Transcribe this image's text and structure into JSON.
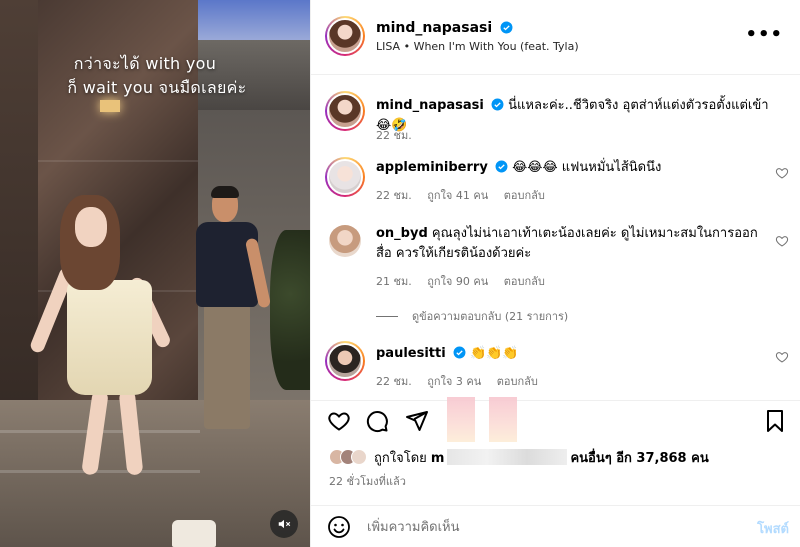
{
  "media": {
    "overlay_line1": "กว่าจะได้ with you",
    "overlay_line2": "ก็ wait you จนมืดเลยค่ะ",
    "mute_icon": "speaker-muted-icon"
  },
  "header": {
    "username": "mind_napasasi",
    "audio": "LISA • When I'm With You (feat. Tyla)",
    "more": "•••"
  },
  "caption": {
    "username": "mind_napasasi",
    "text": "นี่แหละค่ะ..ชีวิตจริง อุตส่าห์แต่งตัวรอตั้งแต่เข้า 😂🤣",
    "time": "22 ชม."
  },
  "comments": [
    {
      "username": "appleminiberry",
      "text": "😂😂😂 แฟนหมั่นไส้นิดนึง",
      "time": "22 ชม.",
      "likes": "ถูกใจ 41 คน",
      "reply": "ตอบกลับ"
    },
    {
      "username": "on_byd",
      "text": "คุณลุงไม่น่าเอาเท้าเตะน้องเลยค่ะ ดูไม่เหมาะสมในการออกสื่อ ควรให้เกียรติน้องด้วยค่ะ",
      "time": "21 ชม.",
      "likes": "ถูกใจ 90 คน",
      "reply": "ตอบกลับ",
      "view_replies": "ดูข้อความตอบกลับ (21 รายการ)"
    },
    {
      "username": "paulesitti",
      "text": "👏👏👏",
      "time": "22 ชม.",
      "likes": "ถูกใจ 3 คน",
      "reply": "ตอบกลับ"
    }
  ],
  "likes_line": {
    "prefix": "ถูกใจโดย",
    "blurred_name": "m",
    "suffix": "คนอื่นๆ อีก 37,868 คน"
  },
  "time_ago": "22 ชั่วโมงที่แล้ว",
  "composer": {
    "placeholder": "เพิ่มความคิดเห็น",
    "post_label": "โพสต์"
  },
  "colors": {
    "verified": "#0095f6",
    "muted_text": "#737373",
    "post_disabled": "#b3dbff"
  }
}
